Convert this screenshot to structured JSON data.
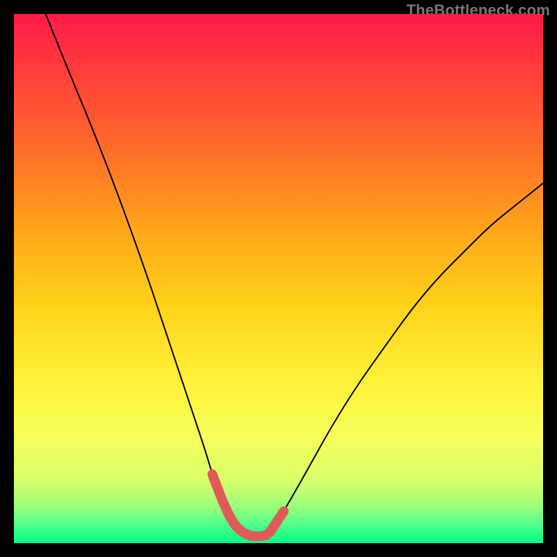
{
  "watermark": "TheBottleneck.com",
  "chart_data": {
    "type": "line",
    "title": "",
    "xlabel": "",
    "ylabel": "",
    "xlim": [
      0,
      100
    ],
    "ylim": [
      0,
      100
    ],
    "grid": false,
    "series": [
      {
        "name": "bottleneck-curve",
        "color": "#000000",
        "stroke_width": 2,
        "x": [
          6,
          10,
          15,
          20,
          25,
          28,
          30,
          32,
          34,
          36,
          37.5,
          39,
          40.5,
          42,
          44,
          46,
          48,
          49,
          51,
          55,
          60,
          65,
          70,
          75,
          80,
          85,
          90,
          95,
          100
        ],
        "y": [
          100,
          90,
          78,
          65,
          51,
          42,
          36,
          30,
          24,
          18,
          13,
          9,
          5.5,
          3,
          1.5,
          1.2,
          1.5,
          3,
          6,
          13,
          22,
          30,
          37,
          44,
          50,
          55,
          60,
          64,
          68
        ]
      },
      {
        "name": "valley-highlight",
        "color": "#e05a5a",
        "stroke_width": 14,
        "linecap": "round",
        "x": [
          37.5,
          39,
          40.5,
          42,
          44,
          46,
          48,
          49,
          51
        ],
        "y": [
          13,
          9,
          5.5,
          3,
          1.5,
          1.2,
          1.5,
          3,
          6
        ]
      }
    ]
  }
}
